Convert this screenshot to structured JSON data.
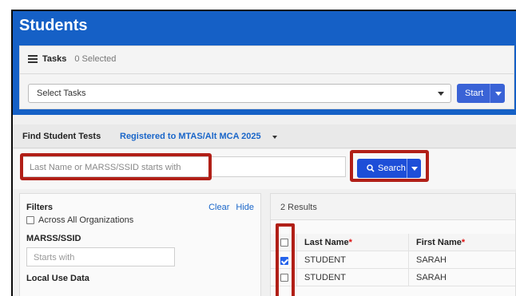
{
  "page": {
    "title": "Students"
  },
  "tasks": {
    "label": "Tasks",
    "selected_count": "0 Selected",
    "select_placeholder": "Select Tasks",
    "start_label": "Start"
  },
  "find": {
    "label": "Find Student Tests",
    "filter_value": "Registered to MTAS/Alt MCA 2025",
    "search_placeholder": "Last Name or MARSS/SSID starts with",
    "search_label": "Search"
  },
  "filters": {
    "title": "Filters",
    "clear_label": "Clear",
    "hide_label": "Hide",
    "across_label": "Across All Organizations",
    "marss_label": "MARSS/SSID",
    "marss_placeholder": "Starts with",
    "local_label": "Local Use Data"
  },
  "results": {
    "count_text": "2 Results",
    "columns": {
      "last": "Last Name",
      "first": "First Name",
      "required_marker": "*"
    },
    "rows": [
      {
        "last": "STUDENT",
        "first": "SARAH",
        "checked": true
      },
      {
        "last": "STUDENT",
        "first": "SARAH",
        "checked": false
      }
    ]
  },
  "colors": {
    "header_blue": "#1560c6",
    "button_blue": "#1d4ed8",
    "highlight_red": "#b11f17"
  },
  "icons": {
    "tasks": "list-icon",
    "search": "magnifier-icon"
  }
}
